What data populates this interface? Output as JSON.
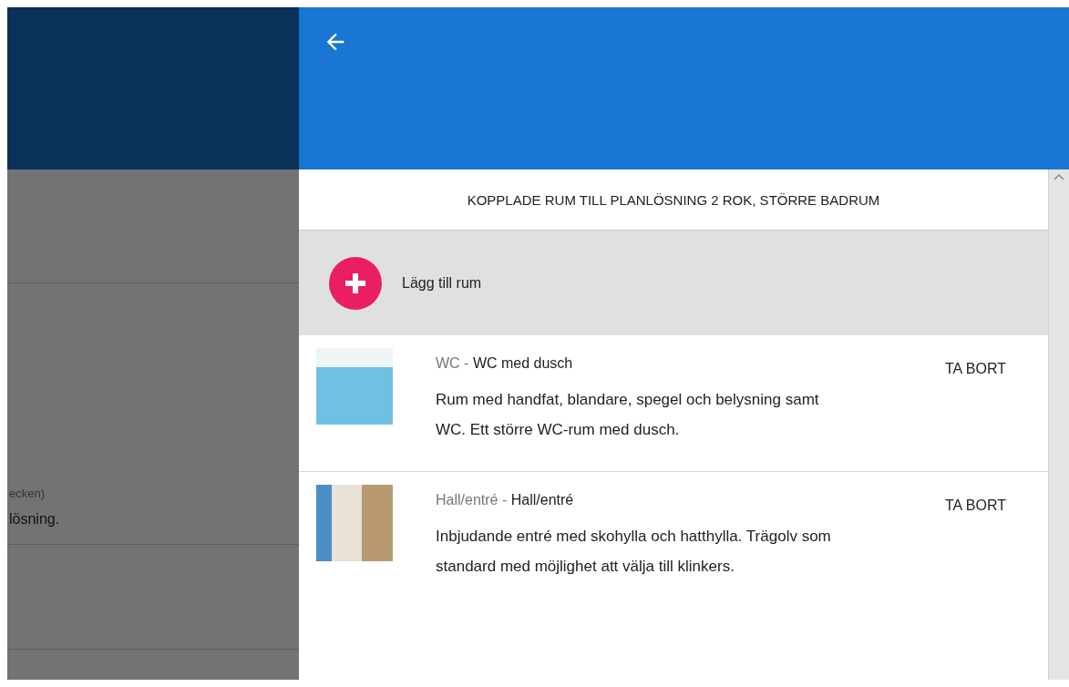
{
  "background": {
    "texts": [
      {
        "kind": "hint",
        "text": "ecken)"
      },
      {
        "kind": "value",
        "text": "lösning."
      }
    ]
  },
  "drawer": {
    "title": "KOPPLADE RUM TILL PLANLÖSNING 2 ROK, STÖRRE BADRUM",
    "add_button": {
      "label": "Lägg till rum"
    },
    "rooms": [
      {
        "category": "WC",
        "separator": "-",
        "name": "WC med dusch",
        "description": "Rum med handfat, blandare, spegel och belysning samt WC. Ett större WC-rum med dusch.",
        "action": "TA BORT"
      },
      {
        "category": "Hall/entré",
        "separator": "-",
        "name": "Hall/entré",
        "description": "Inbjudande entré med skohylla och hatthylla. Trägolv som standard med möjlighet att välja till klinkers.",
        "action": "TA BORT"
      }
    ]
  }
}
